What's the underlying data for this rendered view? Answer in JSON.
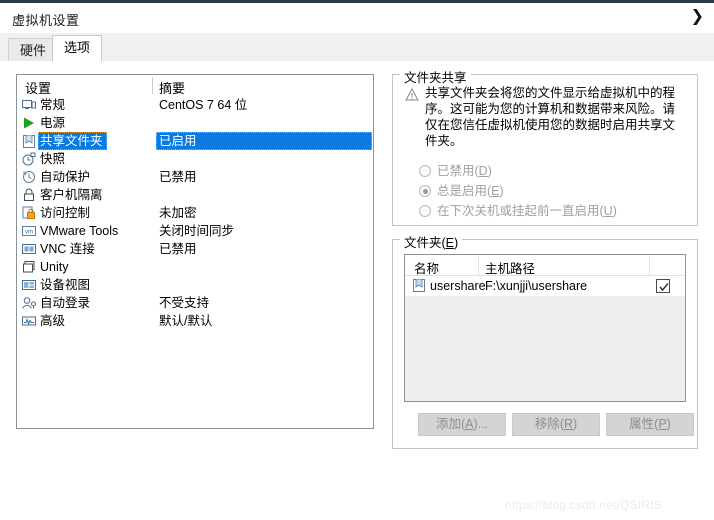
{
  "window": {
    "title": "虚拟机设置",
    "chevron": "❯"
  },
  "tabs": [
    {
      "label": "硬件",
      "active": false
    },
    {
      "label": "选项",
      "active": true
    }
  ],
  "settings_list": {
    "columns": [
      "设置",
      "摘要"
    ],
    "rows": [
      {
        "icon": "monitor-icon",
        "label": "常规",
        "summary": "CentOS 7 64 位",
        "selected": false
      },
      {
        "icon": "power-play-icon",
        "label": "电源",
        "summary": "",
        "selected": false
      },
      {
        "icon": "shared-folder-icon",
        "label": "共享文件夹",
        "summary": "已启用",
        "selected": true
      },
      {
        "icon": "snapshot-clock-icon",
        "label": "快照",
        "summary": "",
        "selected": false
      },
      {
        "icon": "autoprotect-icon",
        "label": "自动保护",
        "summary": "已禁用",
        "selected": false
      },
      {
        "icon": "lock-icon",
        "label": "客户机隔离",
        "summary": "",
        "selected": false
      },
      {
        "icon": "access-control-icon",
        "label": "访问控制",
        "summary": "未加密",
        "selected": false
      },
      {
        "icon": "vmware-tools-icon",
        "label": "VMware Tools",
        "summary": "关闭时间同步",
        "selected": false
      },
      {
        "icon": "vnc-icon",
        "label": "VNC 连接",
        "summary": "已禁用",
        "selected": false
      },
      {
        "icon": "unity-icon",
        "label": "Unity",
        "summary": "",
        "selected": false
      },
      {
        "icon": "device-view-icon",
        "label": "设备视图",
        "summary": "",
        "selected": false
      },
      {
        "icon": "auto-login-icon",
        "label": "自动登录",
        "summary": "不受支持",
        "selected": false
      },
      {
        "icon": "advanced-icon",
        "label": "高级",
        "summary": "默认/默认",
        "selected": false
      }
    ]
  },
  "folder_sharing": {
    "group_title": "文件夹共享",
    "warning": "共享文件夹会将您的文件显示给虚拟机中的程序。这可能为您的计算机和数据带来风险。请仅在您信任虚拟机使用您的数据时启用共享文件夹。",
    "options": [
      {
        "label_prefix": "已禁用(",
        "accel": "D",
        "label_suffix": ")",
        "checked": false
      },
      {
        "label_prefix": "总是启用(",
        "accel": "E",
        "label_suffix": ")",
        "checked": true
      },
      {
        "label_prefix": "在下次关机或挂起前一直启用(",
        "accel": "U",
        "label_suffix": ")",
        "checked": false
      }
    ]
  },
  "folders": {
    "group_title_prefix": "文件夹(",
    "group_title_accel": "E",
    "group_title_suffix": ")",
    "columns": [
      "名称",
      "主机路径",
      ""
    ],
    "rows": [
      {
        "icon": "shared-folder-icon",
        "name": "usershare",
        "path": "F:\\xunjji\\usershare",
        "enabled": true
      }
    ],
    "buttons": [
      {
        "prefix": "添加(",
        "accel": "A",
        "suffix": ")...",
        "enabled": false
      },
      {
        "prefix": "移除(",
        "accel": "R",
        "suffix": ")",
        "enabled": false
      },
      {
        "prefix": "属性(",
        "accel": "P",
        "suffix": ")",
        "enabled": false
      }
    ]
  },
  "watermark": "https://blog.csdn.net/QSIRIS",
  "colors": {
    "selection_blue": "#0a7ae0",
    "focus_orange": "#f0a030",
    "panel_border": "#8b9298",
    "disabled_text": "#a0a0a0"
  }
}
